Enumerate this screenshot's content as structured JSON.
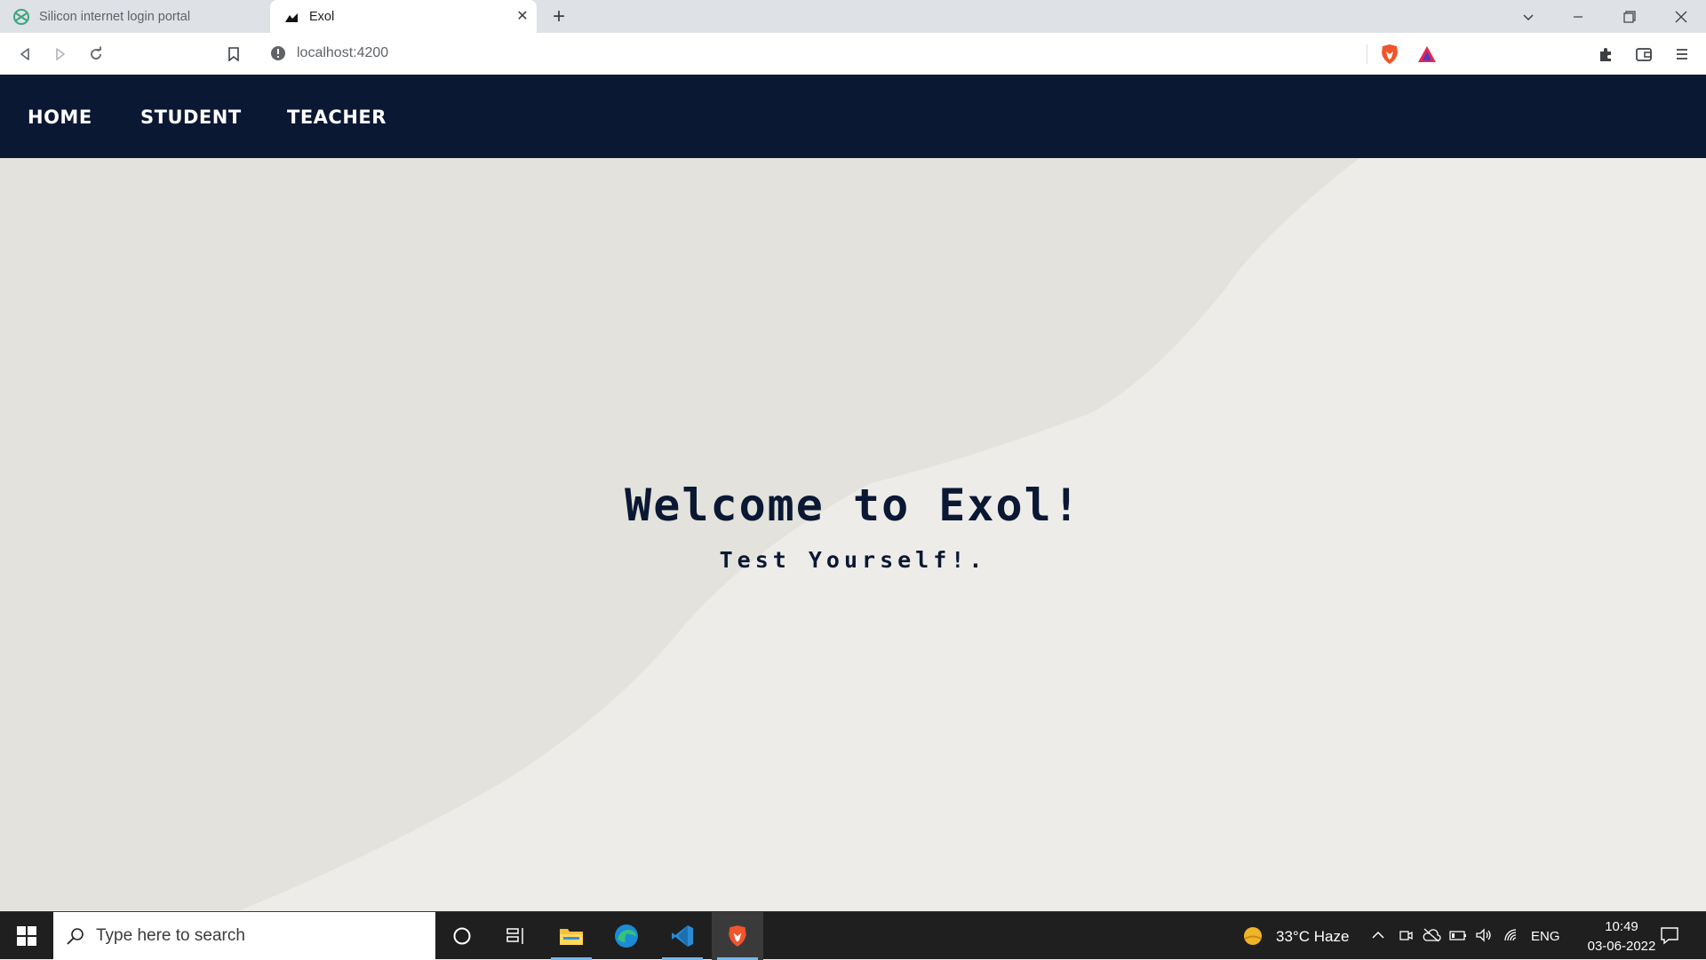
{
  "browser": {
    "tabs": [
      {
        "title": "Silicon internet login portal",
        "active": false
      },
      {
        "title": "Exol",
        "active": true
      }
    ],
    "address": "localhost:4200"
  },
  "nav": {
    "links": [
      "HOME",
      "STUDENT",
      "TEACHER"
    ]
  },
  "hero": {
    "title": "Welcome to Exol!",
    "subtitle": "Test Yourself!."
  },
  "taskbar": {
    "search_placeholder": "Type here to search",
    "weather": "33°C  Haze",
    "language": "ENG",
    "time": "10:49",
    "date": "03-06-2022"
  },
  "colors": {
    "navbar": "#0b1833",
    "page_bg": "#e6e5df",
    "text_dark": "#0b1833"
  }
}
